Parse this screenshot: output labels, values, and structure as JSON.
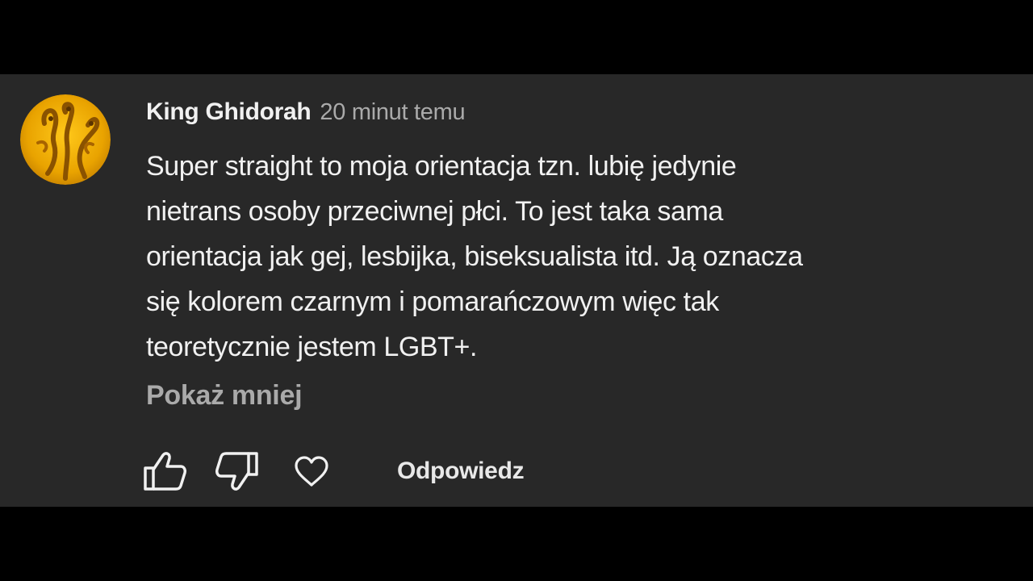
{
  "comment": {
    "author": "King Ghidorah",
    "timestamp": "20 minut temu",
    "lines": [
      "Super straight to moja orientacja tzn. lubię jedynie",
      "nietrans osoby przeciwnej płci. To jest taka sama",
      "orientacja jak gej, lesbijka, biseksualista itd. Ją oznacza",
      "się kolorem czarnym i pomarańczowym więc tak",
      "teoretycznie jestem LGBT+."
    ],
    "show_less_label": "Pokaż mniej",
    "reply_label": "Odpowiedz"
  },
  "icons": {
    "avatar": "avatar-three-headed-dragon",
    "like": "thumbs-up-icon",
    "dislike": "thumbs-down-icon",
    "heart": "heart-icon"
  },
  "colors": {
    "background": "#000000",
    "panel": "#282828",
    "primary_text": "#f1f1f1",
    "secondary_text": "#aaaaaa",
    "avatar_gold": "#e9a800"
  }
}
